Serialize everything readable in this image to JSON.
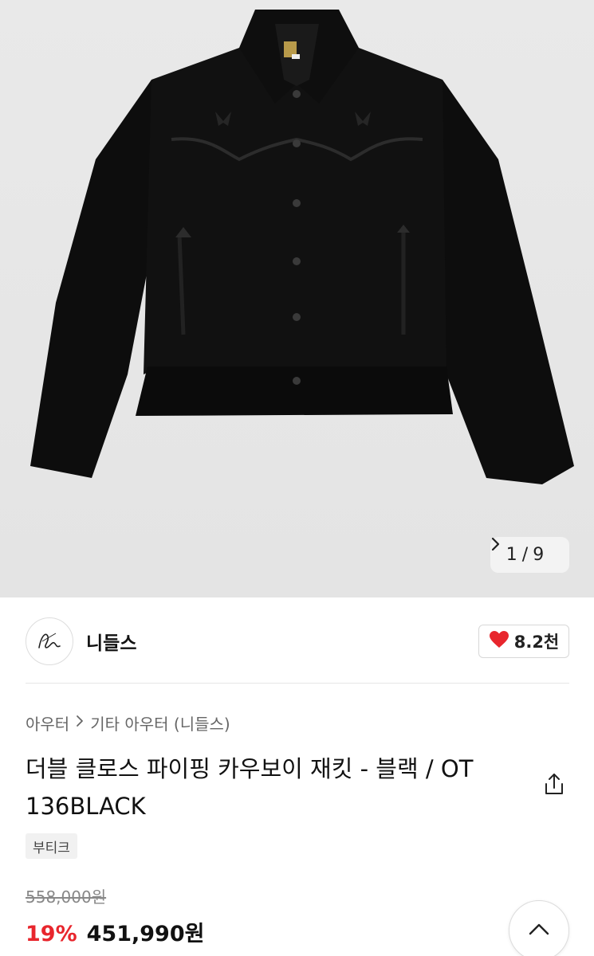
{
  "gallery": {
    "current": "1",
    "separator": "/",
    "total": "9"
  },
  "brand": {
    "name": "니들스",
    "likes": "8.2천"
  },
  "breadcrumb": {
    "category": "아우터",
    "subcategory": "기타 아우터 (니들스)"
  },
  "product": {
    "title_line1": "더블 클로스 파이핑 카우보이 재킷 - 블랙 / OT",
    "title_line2": "136BLACK",
    "tag": "부티크",
    "original_price": "558,000원",
    "discount": "19%",
    "sale_price": "451,990원"
  },
  "colors": {
    "discount": "#e8262d",
    "heart": "#e8262d",
    "hero_bg": "#e7e7e7"
  },
  "icons": [
    "chevron-right-icon",
    "heart-icon",
    "share-icon",
    "chevron-up-icon",
    "brand-logo-icon"
  ]
}
